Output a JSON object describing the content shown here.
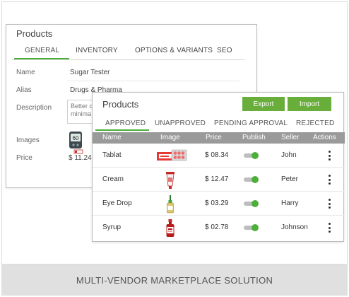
{
  "back_panel": {
    "title": "Products",
    "tabs": [
      "GENERAL",
      "INVENTORY",
      "OPTIONS & VARIANTS",
      "SEO"
    ],
    "fields": {
      "name_label": "Name",
      "name_value": "Sugar Tester",
      "alias_label": "Alias",
      "alias_value": "Drugs & Pharma",
      "description_label": "Description",
      "description_value": "Better c minima",
      "images_label": "Images",
      "price_label": "Price",
      "price_value": "$ 11.24",
      "glucometer_reading": "60"
    }
  },
  "front_panel": {
    "title": "Products",
    "export_label": "Export",
    "import_label": "Import",
    "tabs": [
      "APPROVED",
      "UNAPPROVED",
      "PENDING APPROVAL",
      "REJECTED"
    ],
    "columns": [
      "Name",
      "Image",
      "Price",
      "Publish",
      "Seller",
      "Actions"
    ],
    "rows": [
      {
        "name": "Tablat",
        "image": "tablet-strip-icon",
        "price": "$ 08.34",
        "publish": true,
        "seller": "John"
      },
      {
        "name": "Cream",
        "image": "cream-tube-icon",
        "price": "$ 12.47",
        "publish": true,
        "seller": "Peter"
      },
      {
        "name": "Eye Drop",
        "image": "eye-drop-bottle-icon",
        "price": "$ 03.29",
        "publish": true,
        "seller": "Harry"
      },
      {
        "name": "Syrup",
        "image": "syrup-bottle-icon",
        "price": "$ 02.78",
        "publish": true,
        "seller": "Johnson"
      }
    ]
  },
  "footer": {
    "caption": "MULTI-VENDOR MARKETPLACE SOLUTION"
  },
  "colors": {
    "accent_green": "#69ad3a",
    "toggle_green": "#4caf3a",
    "header_gray": "#9a9a9a",
    "footer_gray": "#e0e0e0"
  }
}
